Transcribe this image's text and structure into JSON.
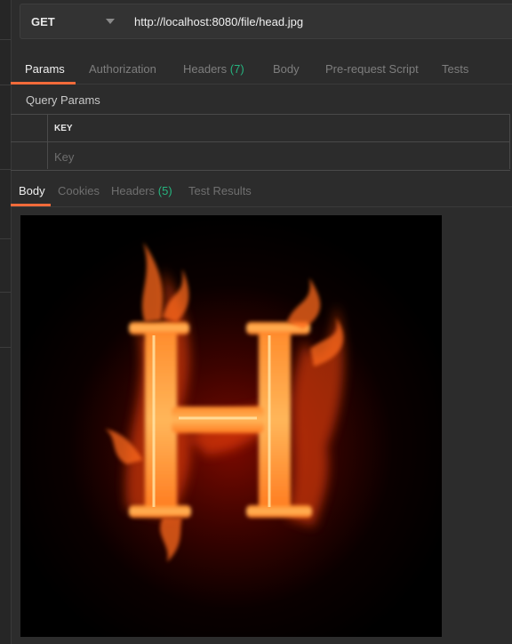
{
  "request": {
    "method": "GET",
    "url": "http://localhost:8080/file/head.jpg"
  },
  "request_tabs": [
    {
      "label": "Params",
      "count": null,
      "active": true
    },
    {
      "label": "Authorization",
      "count": null,
      "active": false
    },
    {
      "label": "Headers",
      "count": "(7)",
      "active": false
    },
    {
      "label": "Body",
      "count": null,
      "active": false
    },
    {
      "label": "Pre-request Script",
      "count": null,
      "active": false
    },
    {
      "label": "Tests",
      "count": null,
      "active": false
    }
  ],
  "query_params": {
    "title": "Query Params",
    "key_header": "KEY",
    "key_placeholder": "Key"
  },
  "response_tabs": [
    {
      "label": "Body",
      "count": null,
      "active": true
    },
    {
      "label": "Cookies",
      "count": null,
      "active": false
    },
    {
      "label": "Headers",
      "count": "(5)",
      "active": false
    },
    {
      "label": "Test Results",
      "count": null,
      "active": false
    }
  ],
  "response_image": {
    "depicts": "flaming letter H",
    "letter": "H"
  },
  "colors": {
    "accent": "#f26b3a",
    "count": "#26b47f",
    "background": "#2c2c2c"
  }
}
